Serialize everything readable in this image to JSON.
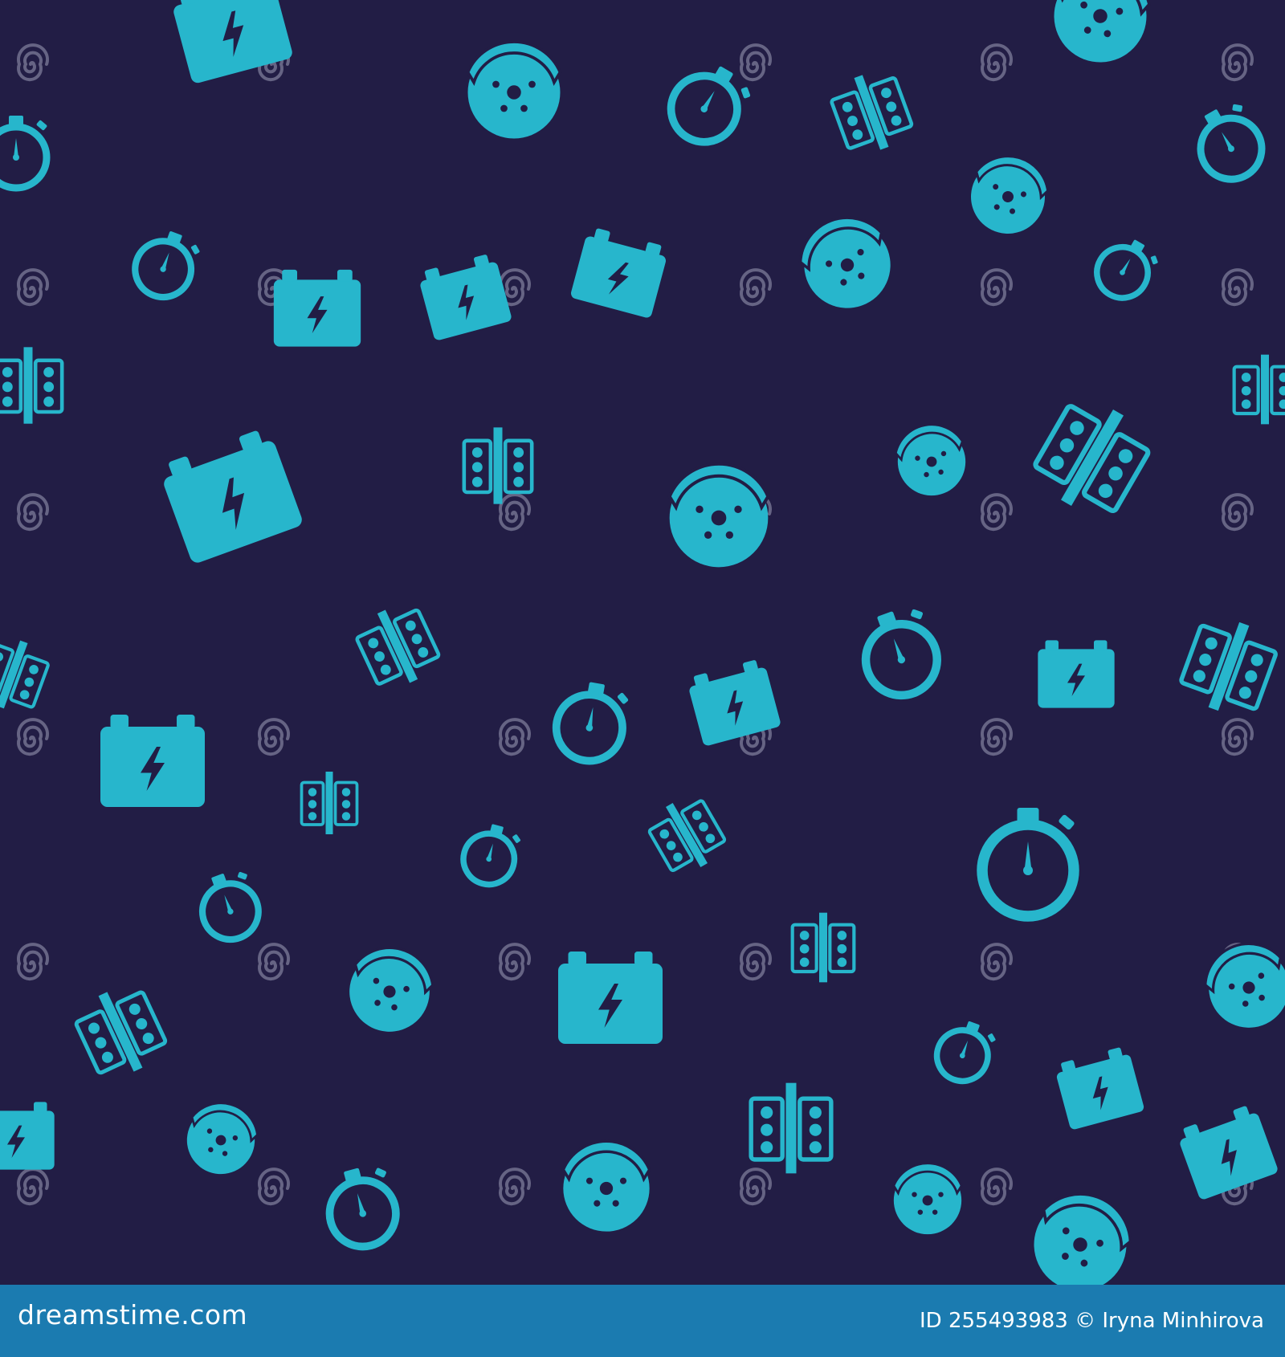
{
  "colors": {
    "background": "#221d45",
    "icon": "#27b6cc",
    "watermark": "#6e6c8b",
    "footer": "#1b7bb0",
    "footer_text": "#ffffff"
  },
  "pattern": {
    "icon_types": [
      "car-battery-icon",
      "brake-disc-icon",
      "stopwatch-icon",
      "race-start-lights-icon"
    ],
    "watermark_text": "dreamstime"
  },
  "footer": {
    "site": "dreamstime.com",
    "id_label": "ID 255493983",
    "author": "© Iryna Minhirova"
  }
}
